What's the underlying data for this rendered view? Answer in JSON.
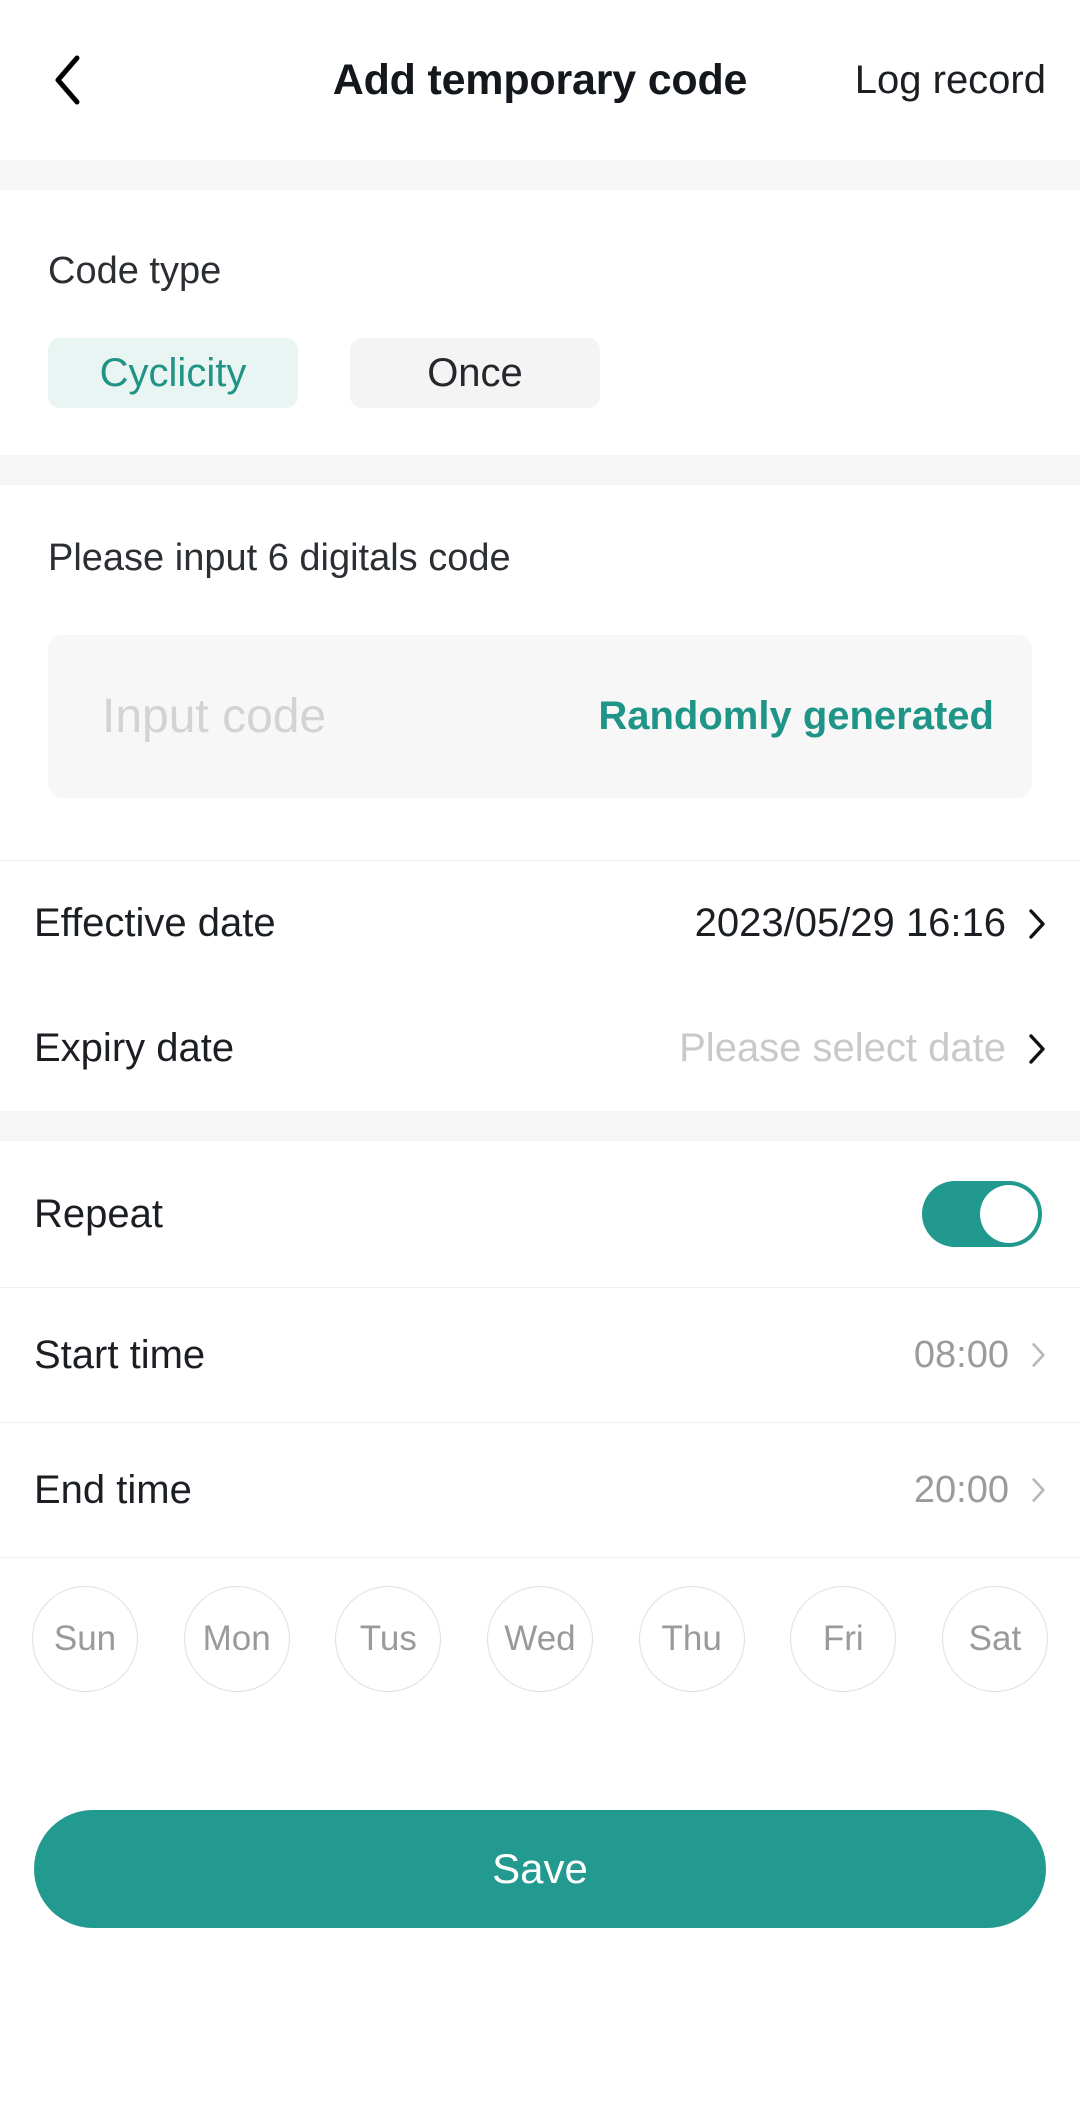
{
  "header": {
    "back_icon": "chevron-left-icon",
    "title": "Add temporary code",
    "action_label": "Log record"
  },
  "code_type": {
    "label": "Code type",
    "options": [
      {
        "label": "Cyclicity",
        "selected": true
      },
      {
        "label": "Once",
        "selected": false
      }
    ]
  },
  "code_input": {
    "label": "Please input 6 digitals code",
    "placeholder": "Input code",
    "value": "",
    "random_button_label": "Randomly generated"
  },
  "dates": {
    "effective": {
      "label": "Effective date",
      "value": "2023/05/29 16:16",
      "chevron_icon": "chevron-right-icon"
    },
    "expiry": {
      "label": "Expiry date",
      "placeholder": "Please select date",
      "value": "",
      "chevron_icon": "chevron-right-icon"
    }
  },
  "repeat": {
    "label": "Repeat",
    "enabled": true
  },
  "times": {
    "start": {
      "label": "Start time",
      "value": "08:00",
      "chevron_icon": "chevron-right-icon"
    },
    "end": {
      "label": "End time",
      "value": "20:00",
      "chevron_icon": "chevron-right-icon"
    }
  },
  "weekdays": [
    {
      "label": "Sun",
      "selected": false
    },
    {
      "label": "Mon",
      "selected": false
    },
    {
      "label": "Tus",
      "selected": false
    },
    {
      "label": "Wed",
      "selected": false
    },
    {
      "label": "Thu",
      "selected": false
    },
    {
      "label": "Fri",
      "selected": false
    },
    {
      "label": "Sat",
      "selected": false
    }
  ],
  "footer": {
    "save_label": "Save"
  },
  "colors": {
    "accent": "#239a8f",
    "accent_tint": "#e9f5f2",
    "band": "#f6f6f6",
    "muted_text": "#9b9b9b"
  }
}
